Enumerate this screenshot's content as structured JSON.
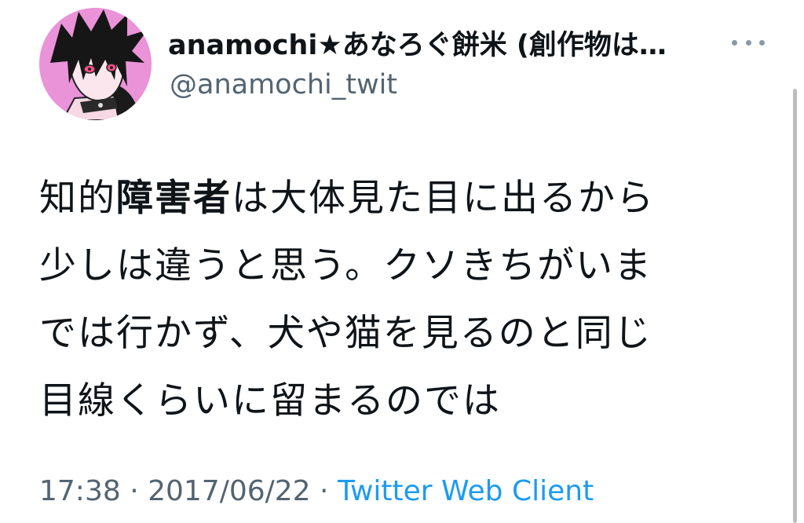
{
  "author": {
    "display_name": "anamochi★あなろぐ餅米 (創作物は…",
    "handle": "@anamochi_twit",
    "avatar_icon": "profile-avatar"
  },
  "more_icon": "more-horizontal-icon",
  "tweet": {
    "lines": [
      {
        "before": "知的",
        "bold": "障害者",
        "after": "は大体見た目に出るから"
      },
      {
        "text": "少しは違うと思う。クソきちがいま"
      },
      {
        "text": "では行かず、犬や猫を見るのと同じ"
      },
      {
        "text": "目線くらいに留まるのでは"
      }
    ]
  },
  "meta": {
    "time": "17:38",
    "separator1": " · ",
    "date": "2017/06/22",
    "separator2": " · ",
    "client": "Twitter Web Client"
  },
  "colors": {
    "text": "#0f1419",
    "secondary": "#536471",
    "link": "#1d9bf0",
    "background": "#ffffff"
  }
}
